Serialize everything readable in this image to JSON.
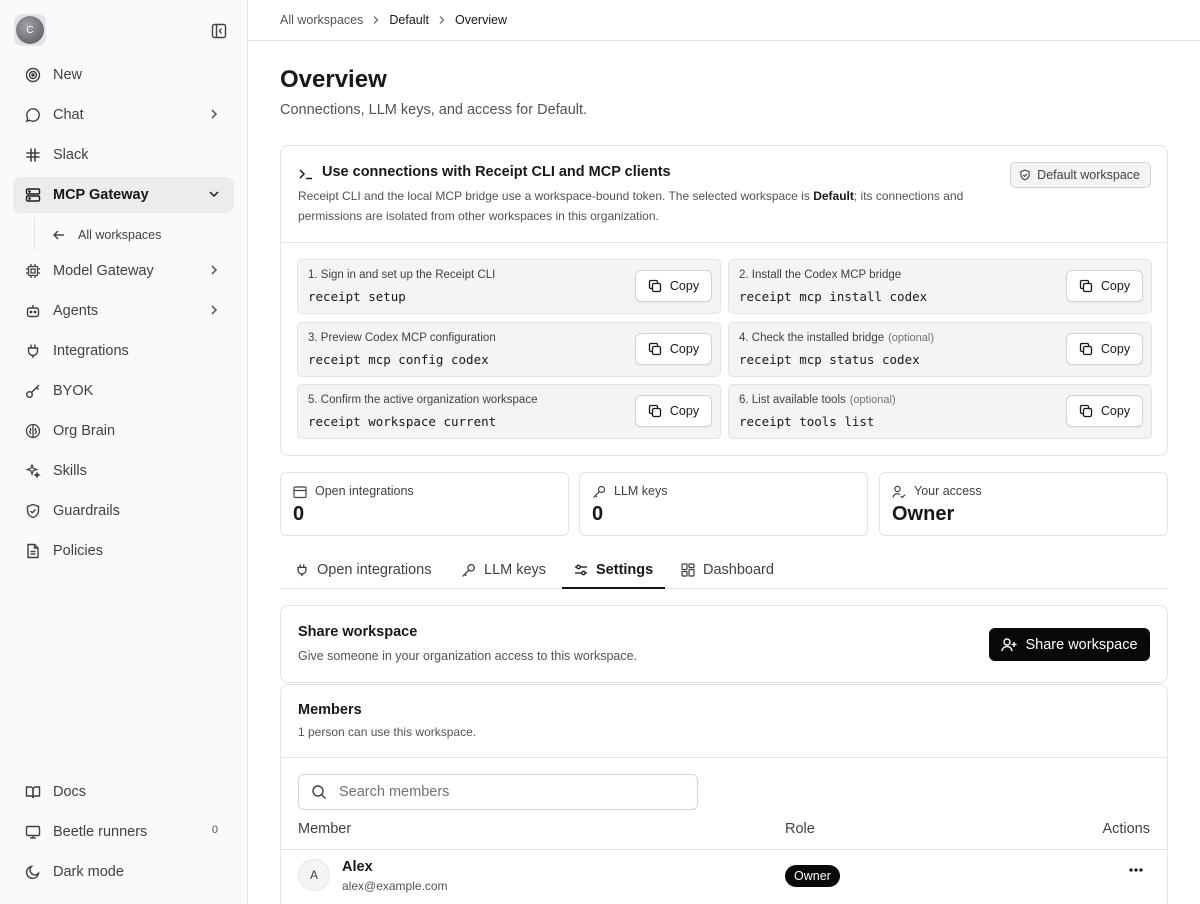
{
  "sidebar": {
    "avatar_initial": "C",
    "items": [
      {
        "label": "New"
      },
      {
        "label": "Chat"
      },
      {
        "label": "Slack"
      },
      {
        "label": "MCP Gateway"
      },
      {
        "label": "Model Gateway"
      },
      {
        "label": "Agents"
      },
      {
        "label": "Integrations"
      },
      {
        "label": "BYOK"
      },
      {
        "label": "Org Brain"
      },
      {
        "label": "Skills"
      },
      {
        "label": "Guardrails"
      },
      {
        "label": "Policies"
      }
    ],
    "sub_item": "All workspaces",
    "bottom": [
      {
        "label": "Docs"
      },
      {
        "label": "Beetle runners",
        "badge": "0"
      },
      {
        "label": "Dark mode"
      }
    ]
  },
  "breadcrumb": [
    "All workspaces",
    "Default",
    "Overview"
  ],
  "page": {
    "title": "Overview",
    "subtitle": "Connections, LLM keys, and access for Default."
  },
  "cli": {
    "title": "Use connections with Receipt CLI and MCP clients",
    "desc_pre": "Receipt CLI and the local MCP bridge use a workspace-bound token. The selected workspace is ",
    "desc_bold": "Default",
    "desc_post": "; its connections and permissions are isolated from other workspaces in this organization.",
    "badge": "Default workspace",
    "copy_label": "Copy",
    "steps": [
      {
        "label": "1. Sign in and set up the Receipt CLI",
        "optional": "",
        "command": "receipt setup"
      },
      {
        "label": "2. Install the Codex MCP bridge",
        "optional": "",
        "command": "receipt mcp install codex"
      },
      {
        "label": "3. Preview Codex MCP configuration",
        "optional": "",
        "command": "receipt mcp config codex"
      },
      {
        "label": "4. Check the installed bridge",
        "optional": "(optional)",
        "command": "receipt mcp status codex"
      },
      {
        "label": "5. Confirm the active organization workspace",
        "optional": "",
        "command": "receipt workspace current"
      },
      {
        "label": "6. List available tools",
        "optional": "(optional)",
        "command": "receipt tools list"
      }
    ]
  },
  "stats": [
    {
      "label": "Open integrations",
      "value": "0"
    },
    {
      "label": "LLM keys",
      "value": "0"
    },
    {
      "label": "Your access",
      "value": "Owner"
    }
  ],
  "tabs": [
    {
      "label": "Open integrations"
    },
    {
      "label": "LLM keys"
    },
    {
      "label": "Settings",
      "active": true
    },
    {
      "label": "Dashboard"
    }
  ],
  "share": {
    "title": "Share workspace",
    "subtitle": "Give someone in your organization access to this workspace.",
    "button": "Share workspace"
  },
  "members": {
    "title": "Members",
    "subtitle": "1 person can use this workspace.",
    "search_placeholder": "Search members",
    "columns": [
      "Member",
      "Role",
      "Actions"
    ],
    "rows": [
      {
        "initial": "A",
        "name": "Alex",
        "email": "alex@example.com",
        "role": "Owner"
      }
    ]
  }
}
